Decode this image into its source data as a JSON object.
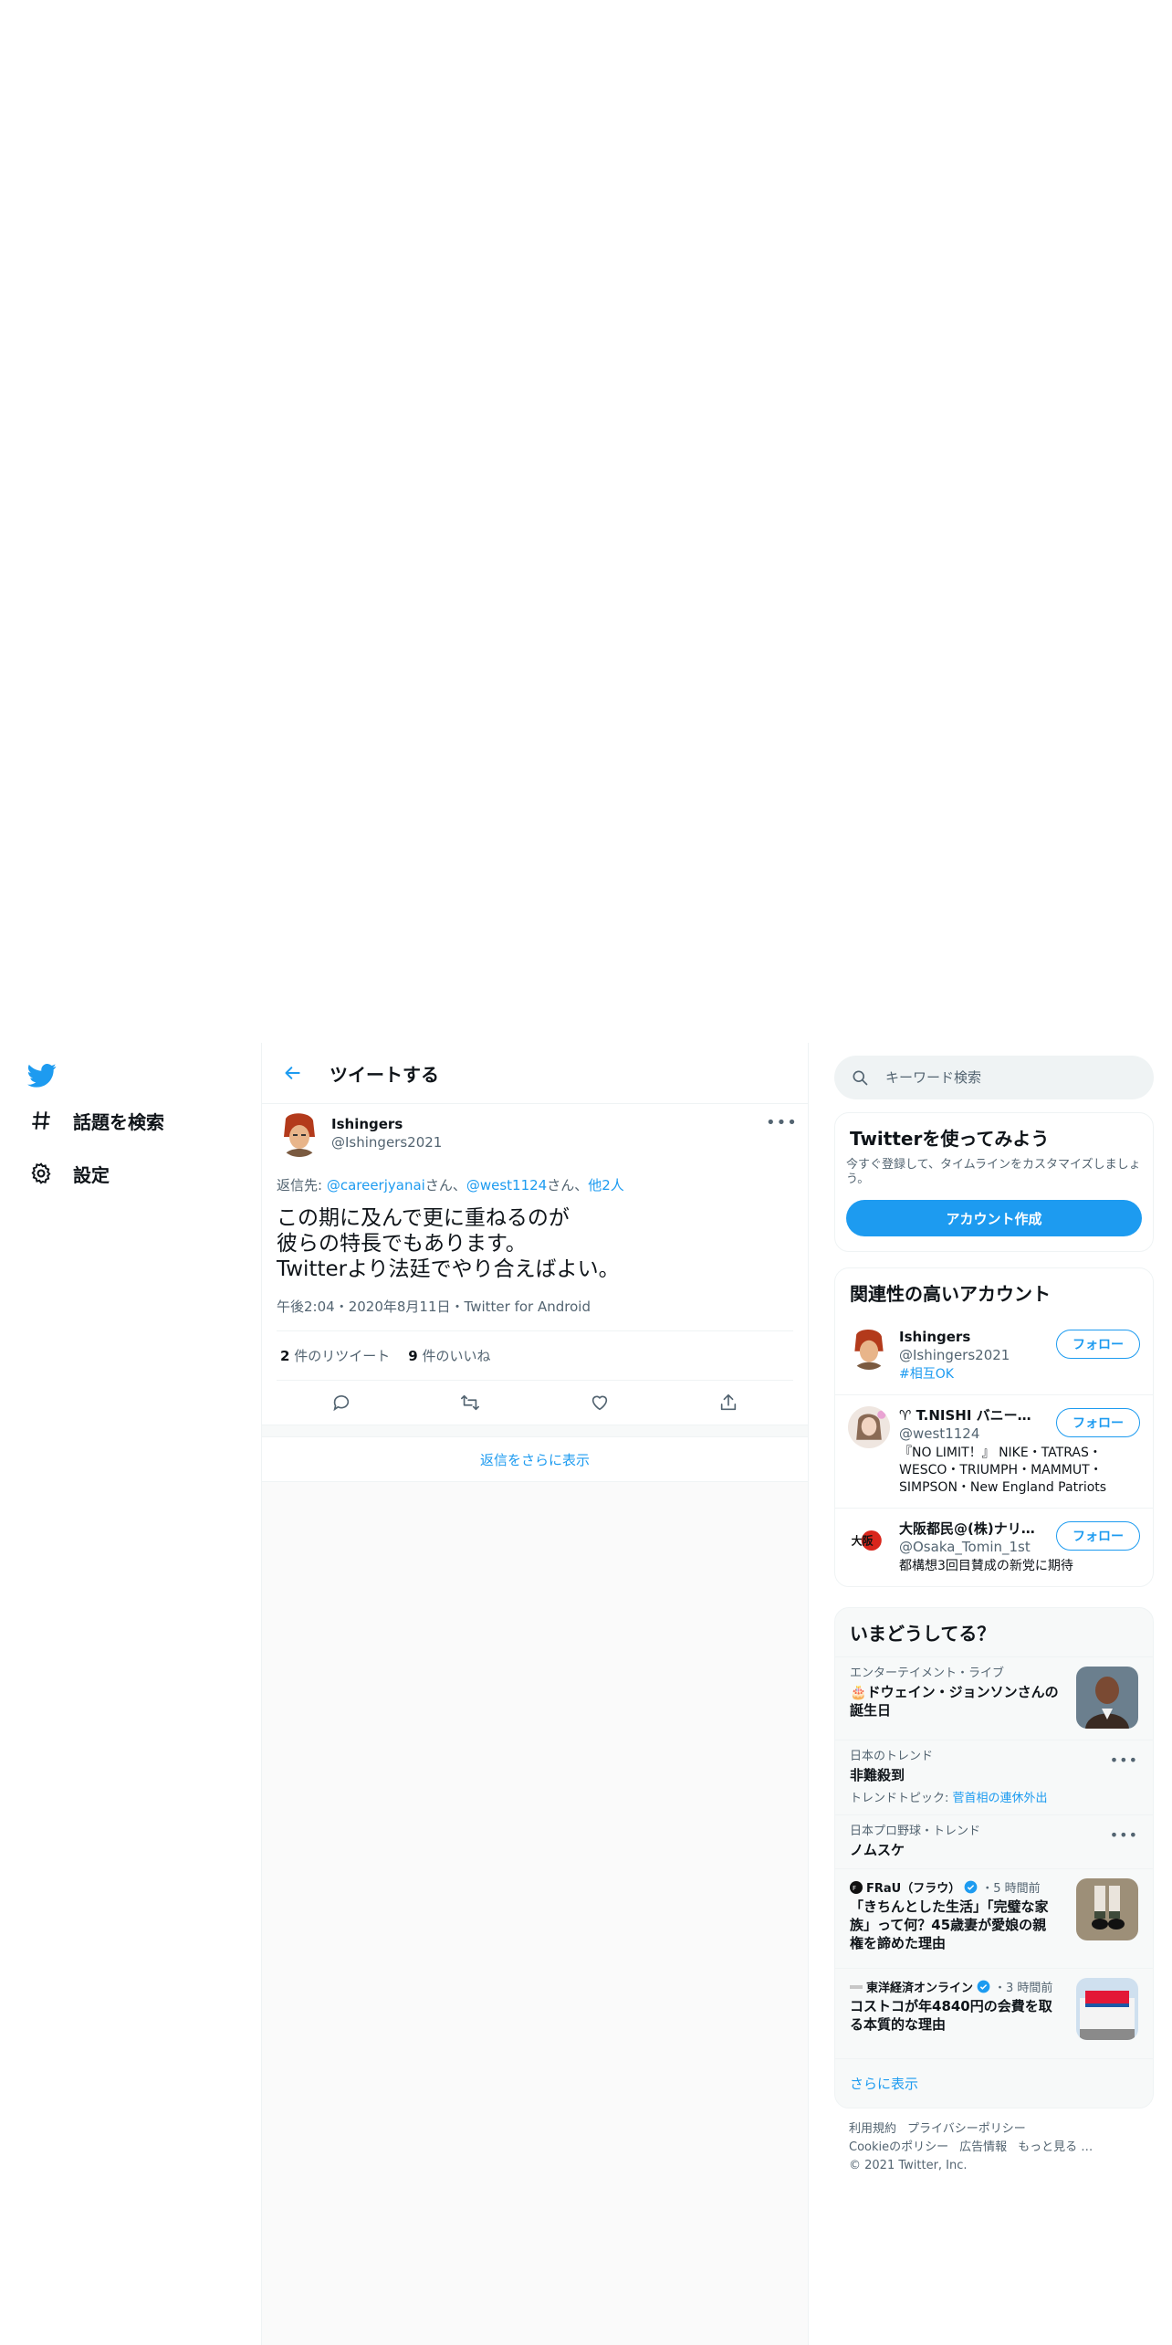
{
  "nav": {
    "items": [
      {
        "label": "話題を検索",
        "icon": "hash-icon"
      },
      {
        "label": "設定",
        "icon": "gear-icon"
      }
    ]
  },
  "main": {
    "header_title": "ツイートする",
    "tweet": {
      "author_name": "Ishingers",
      "author_handle": "@Ishingers2021",
      "reply_prefix": "返信先: ",
      "reply_user1": "@careerjyanai",
      "reply_san1": "さん、",
      "reply_user2": "@west1124",
      "reply_san2": "さん、",
      "reply_others": "他2人",
      "text_lines": [
        "この期に及んで更に重ねるのが",
        "彼らの特長でもあります。",
        "Twitterより法廷でやり合えばよい。"
      ],
      "time": "午後2:04",
      "date": "2020年8月11日",
      "source": "Twitter for Android",
      "retweet_count": "2",
      "retweet_label": "件のリツイート",
      "like_count": "9",
      "like_label": "件のいいね"
    },
    "show_more_replies": "返信をさらに表示"
  },
  "sidebar": {
    "search_placeholder": "キーワード検索",
    "signup": {
      "title": "Twitterを使ってみよう",
      "desc": "今すぐ登録して、タイムラインをカスタマイズしましょう。",
      "button": "アカウント作成"
    },
    "related": {
      "title": "関連性の高いアカウント",
      "follow_label": "フォロー",
      "accounts": [
        {
          "name": "Ishingers",
          "handle": "@Ishingers2021",
          "bio": "#相互OK"
        },
        {
          "name": "♈ T.NISHI バニー…",
          "handle": "@west1124",
          "bio": "『NO LIMIT！』 NIKE・TATRAS・WESCO・TRIUMPH・MAMMUT・SIMPSON・New England Patriots"
        },
        {
          "name": "大阪都民@(株)ナリ…",
          "handle": "@Osaka_Tomin_1st",
          "bio": "都構想3回目賛成の新党に期待"
        }
      ]
    },
    "trends": {
      "title": "いまどうしてる？",
      "items": [
        {
          "category": "エンターテイメント・ライブ",
          "title": "🎂ドウェイン・ジョンソンさんの誕生日"
        },
        {
          "category": "日本のトレンド",
          "title": "非難殺到",
          "topic_prefix": "トレンドトピック: ",
          "topic": "菅首相の連休外出"
        },
        {
          "category": "日本プロ野球・トレンド",
          "title": "ノムスケ"
        },
        {
          "source": "FRaU（フラウ）",
          "time": "・5 時間前",
          "title": "「きちんとした生活」「完璧な家族」って何？45歳妻が愛娘の親権を諦めた理由"
        },
        {
          "source": "東洋経済オンライン",
          "time": "・3 時間前",
          "title": "コストコが年4840円の会費を取る本質的な理由"
        }
      ],
      "show_more": "さらに表示"
    },
    "footer": {
      "links_row1": [
        "利用規約",
        "プライバシーポリシー"
      ],
      "links_row2": [
        "Cookieのポリシー",
        "広告情報",
        "もっと見る …"
      ],
      "copyright": "© 2021 Twitter, Inc."
    }
  },
  "colors": {
    "accent": "#1d9bf0",
    "text": "#0f1419",
    "muted": "#536471",
    "border": "#eff3f4"
  }
}
